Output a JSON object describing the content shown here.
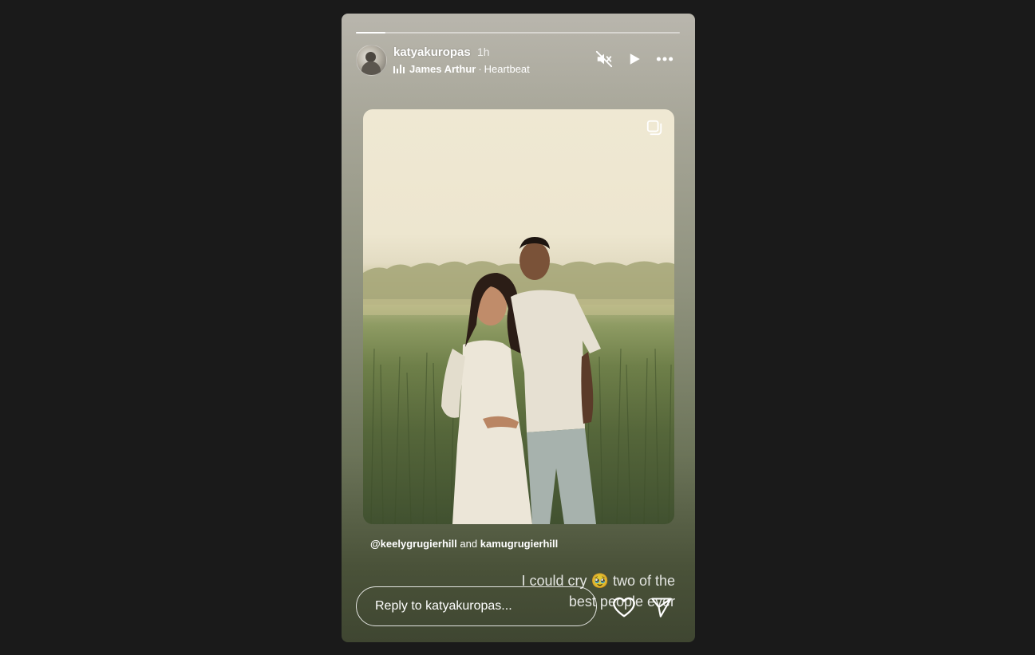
{
  "story": {
    "progress": 0.09,
    "user": {
      "username": "katyakuropas",
      "time_ago": "1h"
    },
    "music": {
      "artist": "James Arthur",
      "separator": "·",
      "song": "Heartbeat"
    },
    "controls": {
      "mute_icon": "muted-speaker-icon",
      "play_icon": "play-icon",
      "more_icon": "more-options-icon"
    },
    "photo": {
      "multi_icon": "carousel-stack-icon"
    },
    "mention": {
      "first": "@keelygrugierhill",
      "connector": "and",
      "second": "kamugrugierhill"
    },
    "caption": {
      "line1_before": "I could cry",
      "emoji": "🥹",
      "line1_after": "two of the",
      "line2": "best people ever"
    },
    "reply": {
      "placeholder": "Reply to katyakuropas..."
    },
    "actions": {
      "like_icon": "heart-icon",
      "share_icon": "send-icon"
    }
  }
}
